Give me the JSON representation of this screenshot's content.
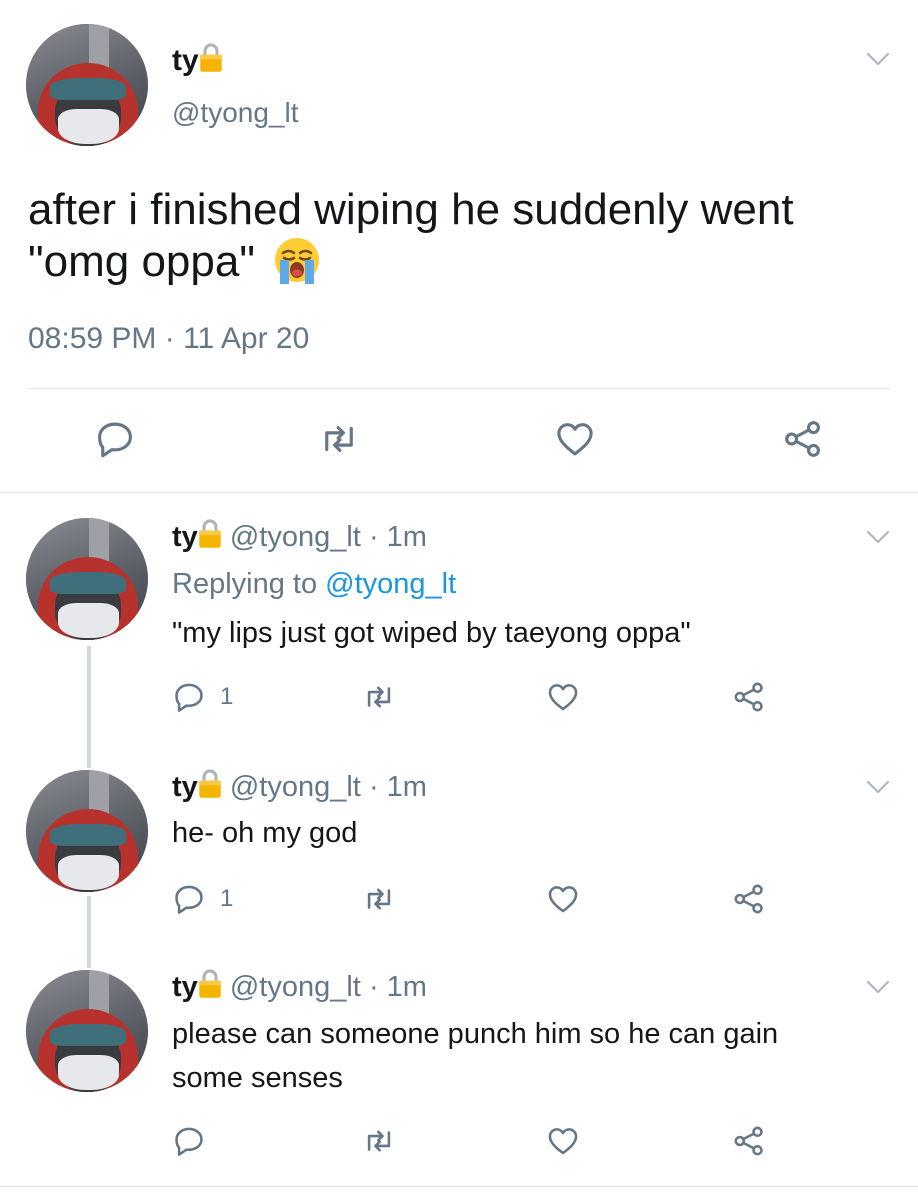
{
  "main_tweet": {
    "display_name": "ty",
    "handle": "@tyong_lt",
    "text_line1": "after i finished wiping he suddenly went",
    "text_line2": "\"omg oppa\"",
    "emoji": "loudly-crying-face",
    "timestamp": "08:59 PM · 11 Apr 20"
  },
  "replies": [
    {
      "display_name": "ty",
      "handle": "@tyong_lt",
      "time": "· 1m",
      "replying_prefix": "Replying to",
      "replying_to": "@tyong_lt",
      "text": "\"my lips just got wiped by taeyong oppa\"",
      "reply_count": "1"
    },
    {
      "display_name": "ty",
      "handle": "@tyong_lt",
      "time": "· 1m",
      "text": "he- oh my god",
      "reply_count": "1"
    },
    {
      "display_name": "ty",
      "handle": "@tyong_lt",
      "time": "· 1m",
      "text_line1": "please can someone punch him so he can gain",
      "text_line2": "some senses"
    }
  ],
  "icons": [
    "reply-icon",
    "retweet-icon",
    "like-icon",
    "share-icon",
    "chevron-down-icon",
    "lock-icon"
  ],
  "colors": {
    "text": "#14171a",
    "secondary": "#657786",
    "link": "#1b95e0",
    "lock": "#f4b400",
    "divider": "#e1e8ed"
  }
}
